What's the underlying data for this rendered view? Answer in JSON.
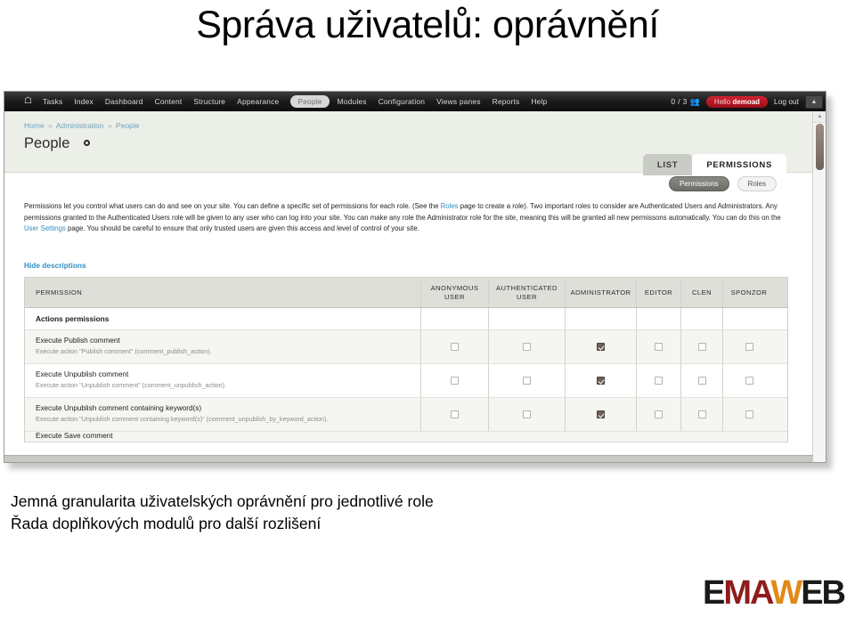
{
  "slide": {
    "title": "Správa uživatelů: oprávnění",
    "caption_line1": "Jemná granularita uživatelských oprávnění pro jednotlivé role",
    "caption_line2": "Řada doplňkových modulů pro další rozlišení"
  },
  "logo": {
    "part1": "E",
    "part2": "MA",
    "part3": "W",
    "part4": "EB"
  },
  "toolbar": {
    "home_icon": "home-icon",
    "items": [
      "Tasks",
      "Index",
      "Dashboard",
      "Content",
      "Structure",
      "Appearance",
      "People",
      "Modules",
      "Configuration",
      "Views panes",
      "Reports",
      "Help"
    ],
    "selected": "People",
    "user_count": "0 / 3",
    "users_icon": "users-icon",
    "greeting_prefix": "Hello ",
    "greeting_user": "demoad",
    "logout": "Log out",
    "collapse_icon": "chevron-up-icon"
  },
  "page": {
    "breadcrumb": [
      "Home",
      "Administration",
      "People"
    ],
    "breadcrumb_sep": "»",
    "title": "People"
  },
  "tabs": [
    {
      "label": "LIST",
      "active": false
    },
    {
      "label": "PERMISSIONS",
      "active": true
    }
  ],
  "subtabs": [
    {
      "label": "Permissions",
      "active": true
    },
    {
      "label": "Roles",
      "active": false
    }
  ],
  "help": {
    "part1": "Permissions let you control what users can do and see on your site. You can define a specific set of permissions for each role. (See the ",
    "link1": "Roles",
    "part2": " page to create a role). Two important roles to consider are Authenticated Users and Administrators. Any permissions granted to the Authenticated Users role will be given to any user who can log into your site. You can make any role the Administrator role for the site, meaning this will be granted all new permissons automatically. You can do this on the ",
    "link2": "User Settings",
    "part3": " page. You should be careful to ensure that only trusted users are given this access and level of control of your site.",
    "hide_descriptions": "Hide descriptions"
  },
  "table": {
    "headers": {
      "permission": "PERMISSION",
      "roles": [
        "ANONYMOUS USER",
        "AUTHENTICATED USER",
        "ADMINISTRATOR",
        "EDITOR",
        "CLEN",
        "SPONZOR"
      ]
    },
    "section": "Actions permissions",
    "rows": [
      {
        "name": "Execute Publish comment",
        "desc": "Execute action \"Publish comment\" (comment_publish_action).",
        "checks": [
          false,
          false,
          true,
          false,
          false,
          false
        ]
      },
      {
        "name": "Execute Unpublish comment",
        "desc": "Execute action \"Unpublish comment\" (comment_unpublish_action).",
        "checks": [
          false,
          false,
          true,
          false,
          false,
          false
        ]
      },
      {
        "name": "Execute Unpublish comment containing keyword(s)",
        "desc": "Execute action \"Unpublish comment containing keyword(s)\" (comment_unpublish_by_keyword_action).",
        "checks": [
          false,
          false,
          true,
          false,
          false,
          false
        ]
      }
    ],
    "cut_row": "Execute Save comment"
  },
  "colors": {
    "accent_link": "#2f8fc4",
    "badge_red": "#b91222",
    "checked_box": "#6d5f56",
    "logo_dark_red": "#8e1d1d",
    "logo_orange": "#e08a19"
  }
}
